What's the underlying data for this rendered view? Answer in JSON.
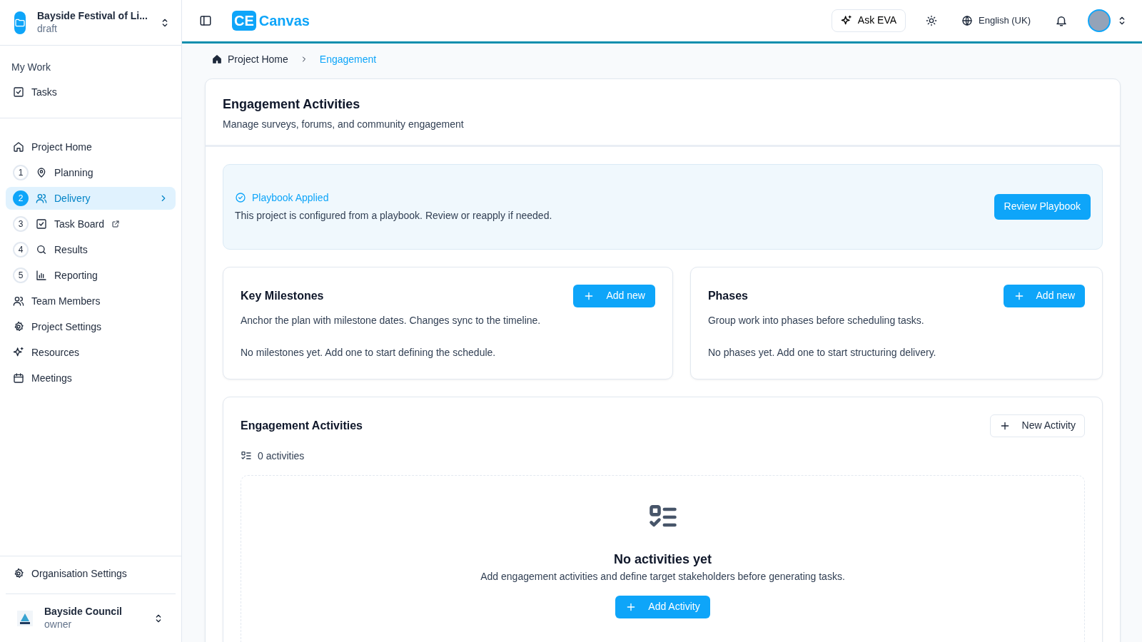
{
  "project": {
    "name": "Bayside Festival of Li...",
    "status": "draft"
  },
  "my_work": {
    "heading": "My Work",
    "items": [
      {
        "label": "Tasks"
      }
    ]
  },
  "nav": [
    {
      "kind": "link",
      "label": "Project Home",
      "selected": false,
      "external": false
    },
    {
      "kind": "step",
      "number": "1",
      "label": "Planning",
      "selected": false,
      "external": false
    },
    {
      "kind": "step",
      "number": "2",
      "label": "Delivery",
      "selected": true,
      "external": false
    },
    {
      "kind": "step",
      "number": "3",
      "label": "Task Board",
      "selected": false,
      "external": true
    },
    {
      "kind": "step",
      "number": "4",
      "label": "Results",
      "selected": false,
      "external": false
    },
    {
      "kind": "step",
      "number": "5",
      "label": "Reporting",
      "selected": false,
      "external": false
    },
    {
      "kind": "link",
      "label": "Team Members",
      "selected": false,
      "external": false
    },
    {
      "kind": "link",
      "label": "Project Settings",
      "selected": false,
      "external": false
    },
    {
      "kind": "link",
      "label": "Resources",
      "selected": false,
      "external": false
    },
    {
      "kind": "link",
      "label": "Meetings",
      "selected": false,
      "external": false
    }
  ],
  "org_settings": "Organisation Settings",
  "org": {
    "name": "Bayside Council",
    "role": "owner"
  },
  "topbar": {
    "logo_mark": "CE",
    "logo_text": "Canvas",
    "ask": "Ask EVA",
    "language": "English (UK)"
  },
  "breadcrumb": [
    {
      "label": "Project Home",
      "selected": false
    },
    {
      "label": "Engagement",
      "selected": true
    }
  ],
  "page": {
    "title": "Engagement Activities",
    "subtitle": "Manage surveys, forums, and community engagement"
  },
  "playbook": {
    "title": "Playbook Applied",
    "text": "This project is configured from a playbook. Review or reapply if needed.",
    "button": "Review Playbook"
  },
  "panels": [
    {
      "title": "Key Milestones",
      "button": "Add new",
      "description": "Anchor the plan with milestone dates. Changes sync to the timeline.",
      "empty": "No milestones yet. Add one to start defining the schedule."
    },
    {
      "title": "Phases",
      "button": "Add new",
      "description": "Group work into phases before scheduling tasks.",
      "empty": "No phases yet. Add one to start structuring delivery."
    }
  ],
  "activities": {
    "title": "Engagement Activities",
    "button": "New Activity",
    "count": "0 activities",
    "empty_title": "No activities yet",
    "empty_text": "Add engagement activities and define target stakeholders before generating tasks.",
    "empty_button": "Add Activity"
  }
}
